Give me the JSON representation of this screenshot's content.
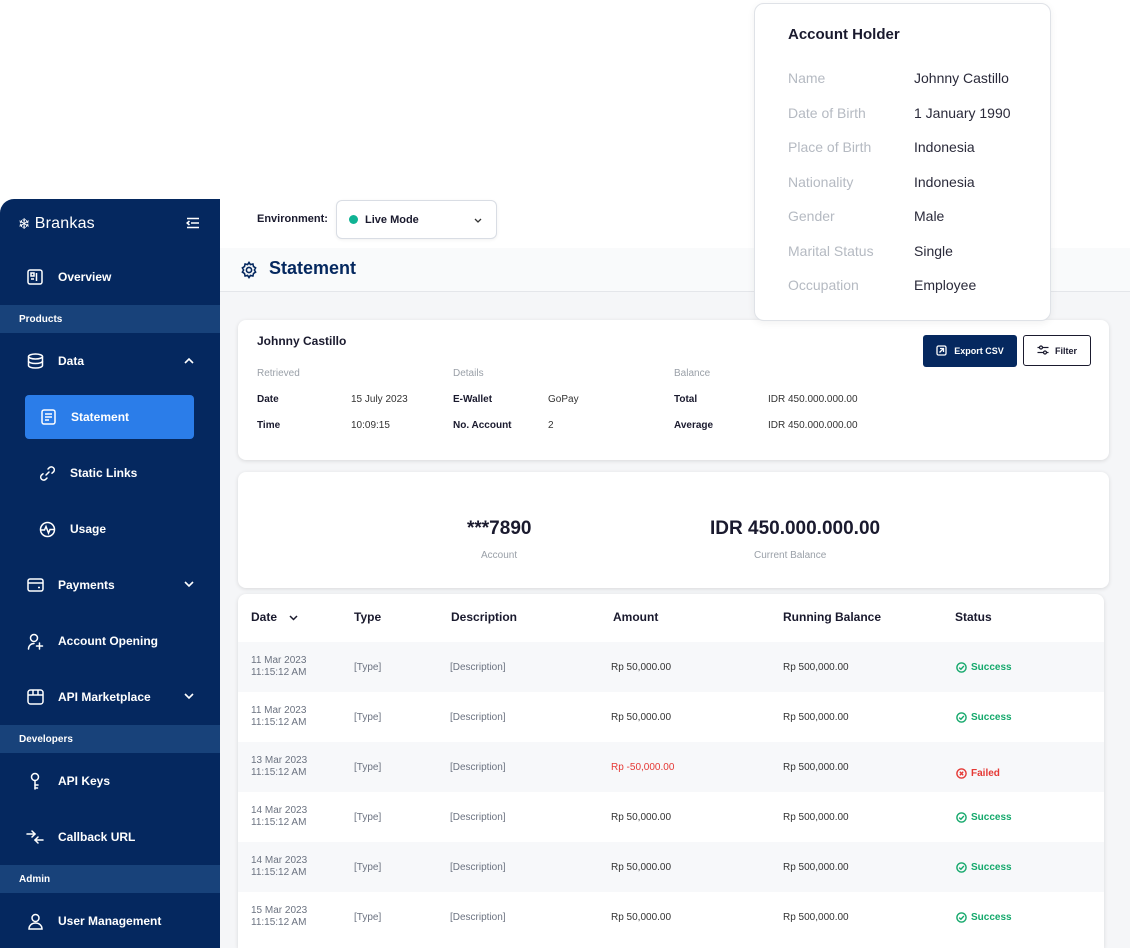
{
  "sidebar": {
    "brand": "Brankas",
    "items": {
      "overview": "Overview",
      "products_section": "Products",
      "data": "Data",
      "statement": "Statement",
      "static_links": "Static Links",
      "usage": "Usage",
      "payments": "Payments",
      "account_opening": "Account Opening",
      "api_marketplace": "API Marketplace",
      "developers_section": "Developers",
      "api_keys": "API Keys",
      "callback_url": "Callback URL",
      "admin_section": "Admin",
      "user_management": "User Management"
    }
  },
  "topbar": {
    "env_label": "Environment:",
    "env_value": "Live Mode",
    "env_status_color": "#10b394"
  },
  "page": {
    "title": "Statement"
  },
  "info": {
    "holder": "Johnny Castillo",
    "retrieved_label": "Retrieved",
    "details_label": "Details",
    "balance_label": "Balance",
    "date_key": "Date",
    "date_val": "15 July 2023",
    "time_key": "Time",
    "time_val": "10:09:15",
    "ewallet_key": "E-Wallet",
    "ewallet_val": "GoPay",
    "noacc_key": "No. Account",
    "noacc_val": "2",
    "total_key": "Total",
    "total_val": "IDR 450.000.000.00",
    "avg_key": "Average",
    "avg_val": "IDR 450.000.000.00",
    "export_label": "Export CSV",
    "filter_label": "Filter"
  },
  "summary": {
    "account_val": "***7890",
    "account_lbl": "Account",
    "balance_val": "IDR 450.000.000.00",
    "balance_lbl": "Current Balance"
  },
  "table": {
    "headers": [
      "Date",
      "Type",
      "Description",
      "Amount",
      "Running Balance",
      "Status"
    ],
    "rows": [
      {
        "date": "11 Mar 2023",
        "time": "11:15:12 AM",
        "type": "[Type]",
        "desc": "[Description]",
        "amount": "Rp 50,000.00",
        "balance": "Rp 500,000.00",
        "status": "Success"
      },
      {
        "date": "11 Mar 2023",
        "time": "11:15:12 AM",
        "type": "[Type]",
        "desc": "[Description]",
        "amount": "Rp 50,000.00",
        "balance": "Rp 500,000.00",
        "status": "Success"
      },
      {
        "date": "13 Mar 2023",
        "time": "11:15:12 AM",
        "type": "[Type]",
        "desc": "[Description]",
        "amount": "Rp -50,000.00",
        "balance": "Rp 500,000.00",
        "status": "Failed"
      },
      {
        "date": "14 Mar 2023",
        "time": "11:15:12 AM",
        "type": "[Type]",
        "desc": "[Description]",
        "amount": "Rp 50,000.00",
        "balance": "Rp 500,000.00",
        "status": "Success"
      },
      {
        "date": "14 Mar 2023",
        "time": "11:15:12 AM",
        "type": "[Type]",
        "desc": "[Description]",
        "amount": "Rp 50,000.00",
        "balance": "Rp 500,000.00",
        "status": "Success"
      },
      {
        "date": "15 Mar 2023",
        "time": "11:15:12 AM",
        "type": "[Type]",
        "desc": "[Description]",
        "amount": "Rp 50,000.00",
        "balance": "Rp 500,000.00",
        "status": "Success"
      }
    ]
  },
  "account_holder": {
    "title": "Account Holder",
    "fields": [
      {
        "k": "Name",
        "v": "Johnny Castillo"
      },
      {
        "k": "Date of Birth",
        "v": "1 January 1990"
      },
      {
        "k": "Place of Birth",
        "v": "Indonesia"
      },
      {
        "k": "Nationality",
        "v": "Indonesia"
      },
      {
        "k": "Gender",
        "v": "Male"
      },
      {
        "k": "Marital Status",
        "v": "Single"
      },
      {
        "k": "Occupation",
        "v": "Employee"
      }
    ]
  },
  "colors": {
    "sidebar": "#05285f",
    "accent": "#2b7de9",
    "success": "#14a86b",
    "failed": "#e53935"
  }
}
